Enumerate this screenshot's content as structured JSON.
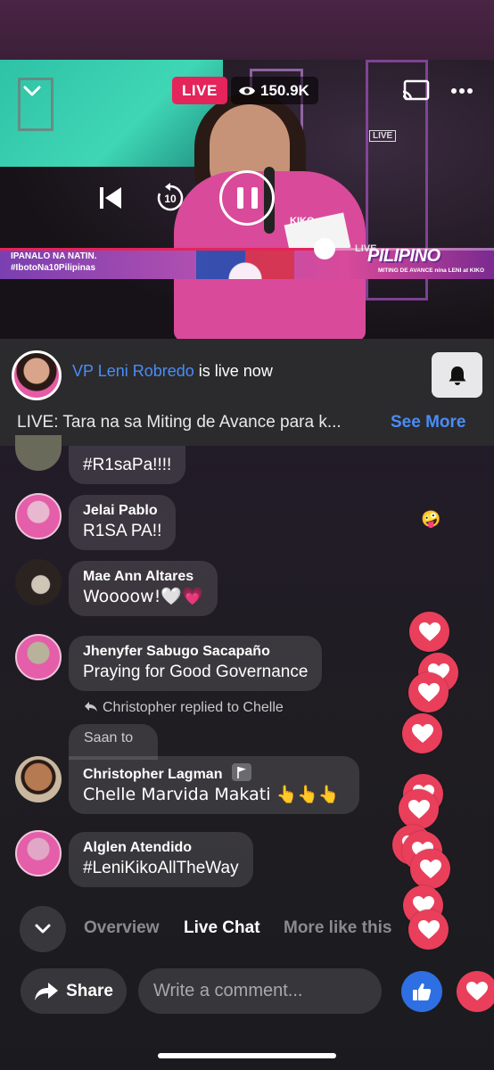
{
  "video": {
    "live_label": "LIVE",
    "viewer_count": "150.9K",
    "progress": 0.66,
    "banner_line1": "IPANALO NA NATIN.",
    "banner_line2": "#IbotoNa10Pilipinas",
    "banner_brand": "PILIPINO",
    "banner_sub": "MITING DE AVANCE nina LENI at KIKO",
    "banner_live": "LIVE",
    "shirt_logo": "KIKO",
    "watermark_live": "LIVE"
  },
  "host": {
    "name": "VP Leni Robredo",
    "status": " is live now",
    "description": "LIVE: Tara na sa Miting de Avance para k...",
    "see_more": "See More"
  },
  "comments": [
    {
      "name": "",
      "text": "#R1saPa!!!!"
    },
    {
      "name": "Jelai Pablo",
      "text": "R1SA PA!!"
    },
    {
      "name": "Mae Ann Altares",
      "text": "Woooow!🤍💗"
    },
    {
      "name": "Jhenyfer Sabugo Sacapaño",
      "text": "Praying for Good Governance"
    },
    {
      "name": "Christopher Lagman",
      "text": "Chelle Marvida Makati 👆👆👆"
    },
    {
      "name": "Alglen Atendido",
      "text": "#LeniKikoAllTheWay"
    }
  ],
  "reply": {
    "notice": "Christopher replied to Chelle",
    "quoted": "Saan  to"
  },
  "tabs": {
    "overview": "Overview",
    "live_chat": "Live Chat",
    "more_like_this": "More like this"
  },
  "bottom": {
    "share": "Share",
    "comment_placeholder": "Write a comment..."
  },
  "colors": {
    "live_red": "#e4245a",
    "link_blue": "#4a8cf7",
    "heart_red": "#e93f5b",
    "like_blue": "#2f6fe4"
  }
}
